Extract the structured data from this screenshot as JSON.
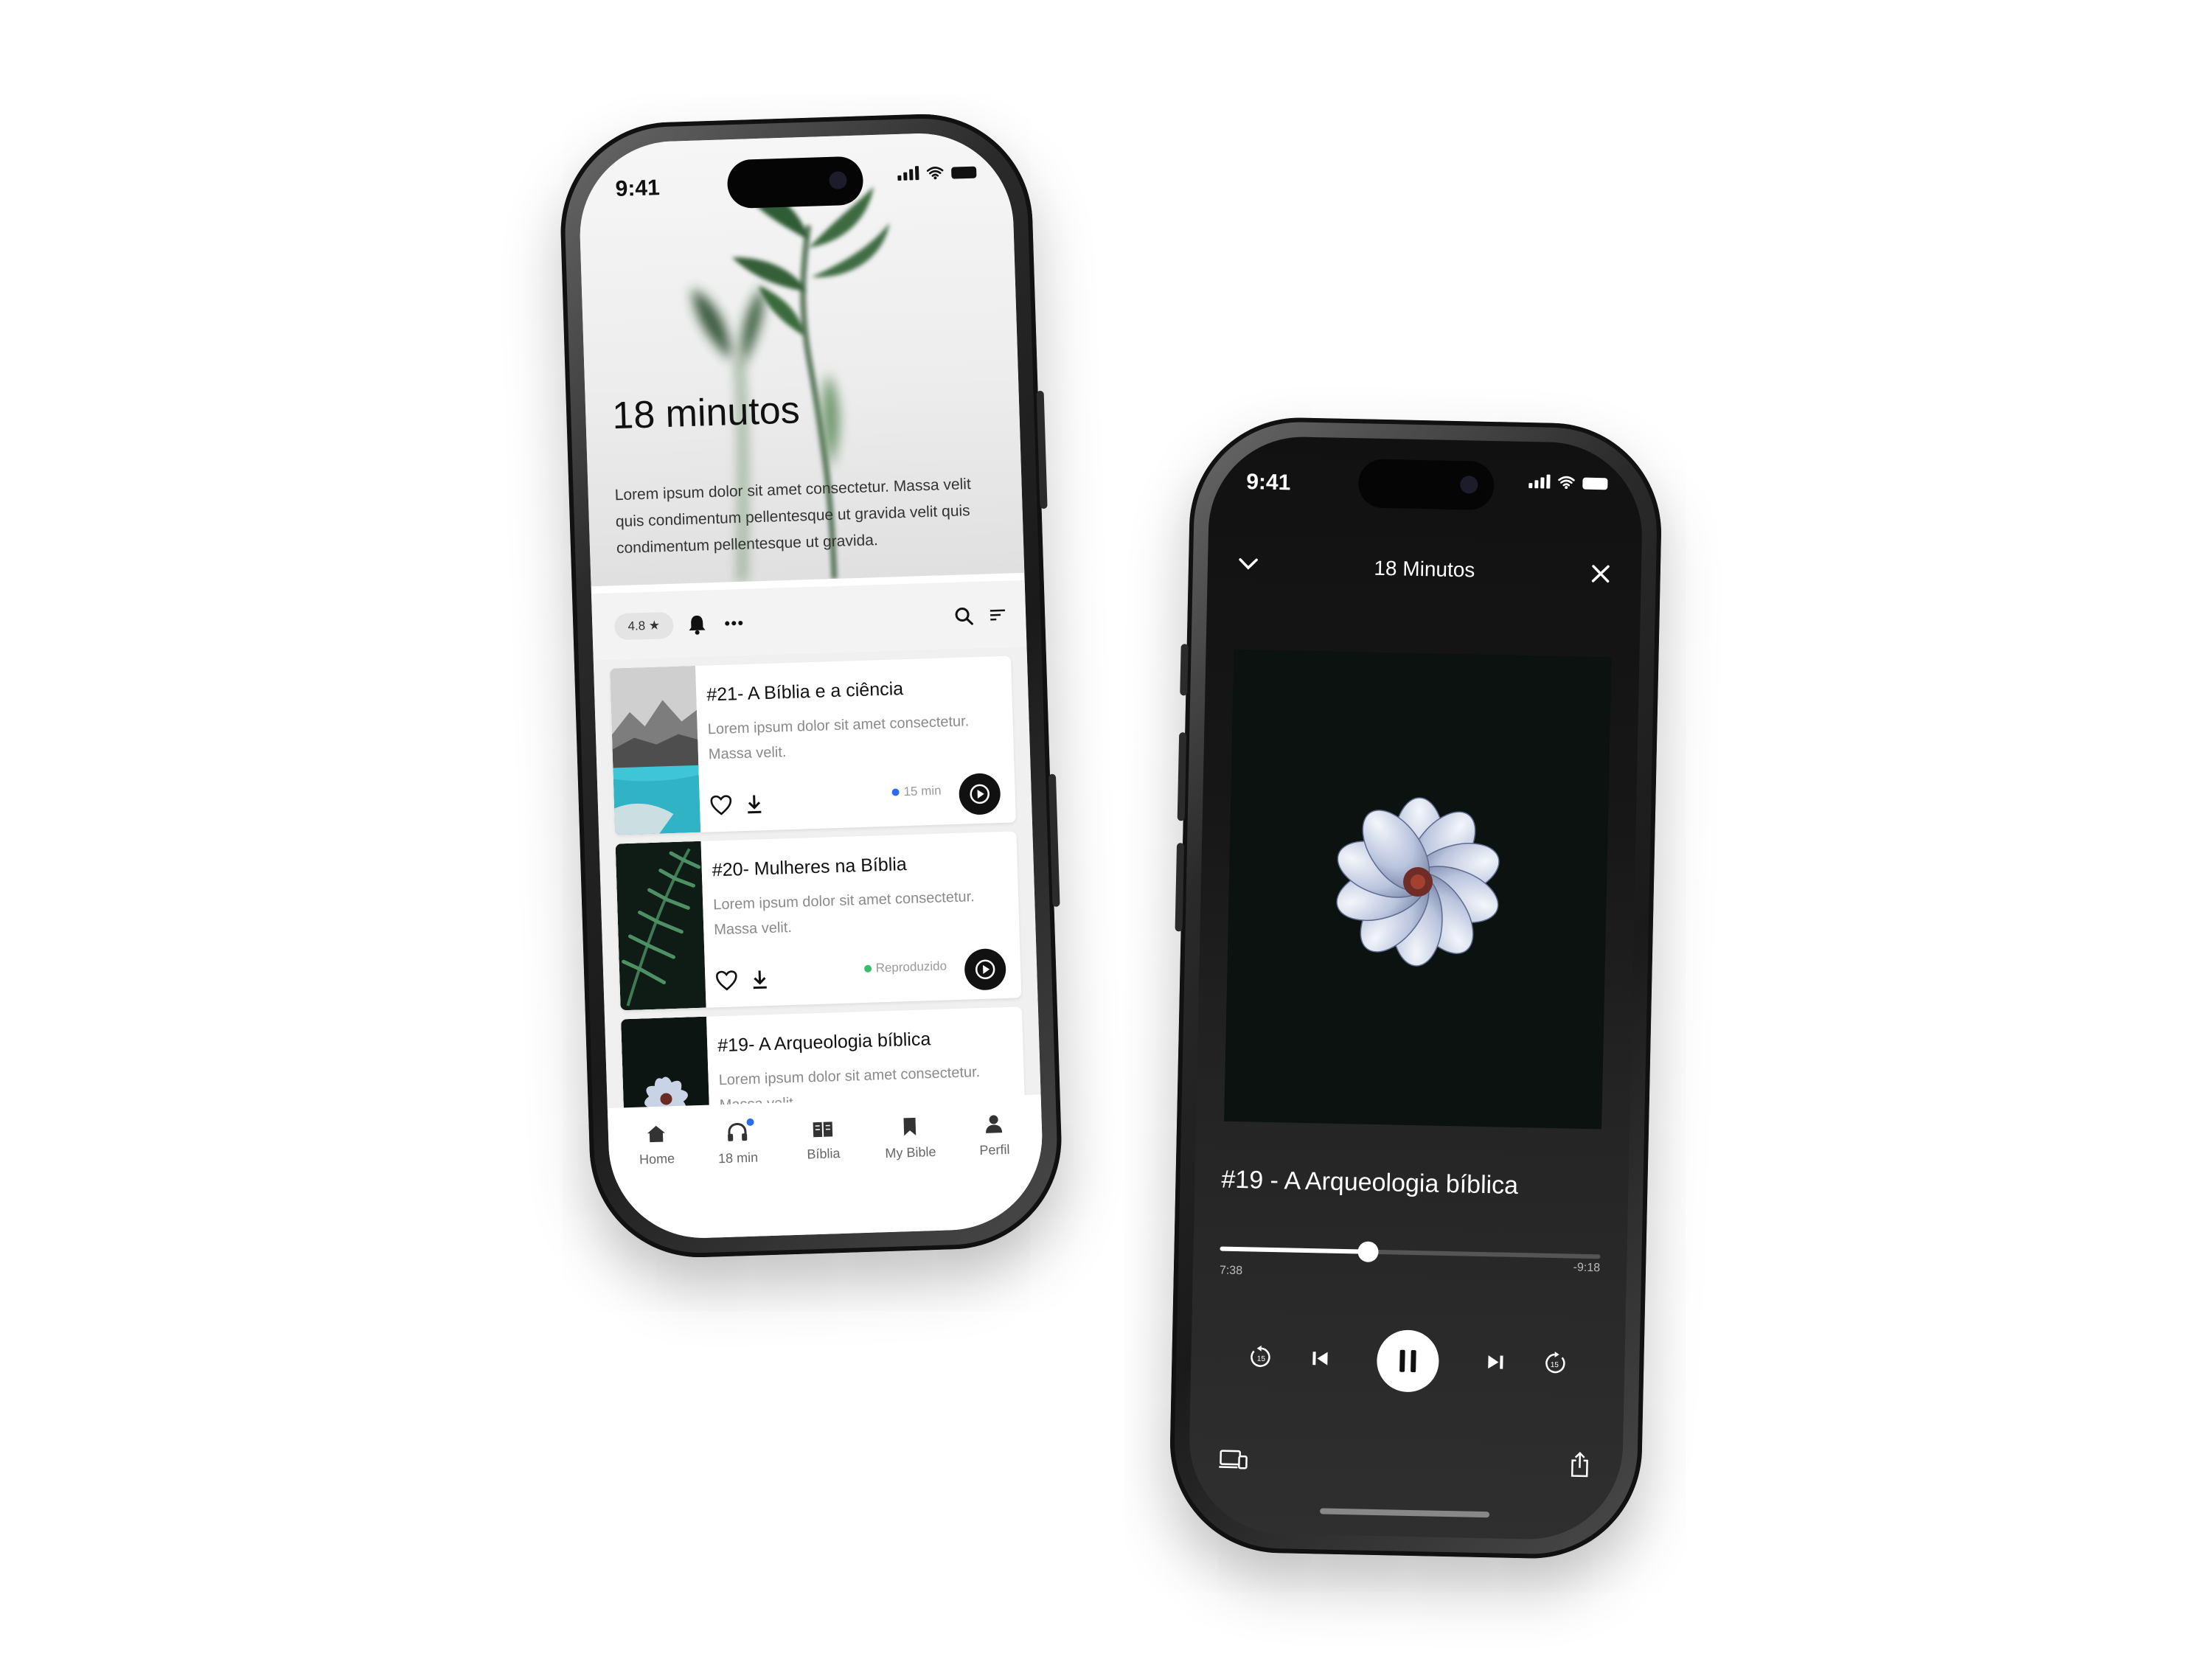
{
  "left_phone": {
    "status_time": "9:41",
    "hero": {
      "title": "18 minutos",
      "description": "Lorem ipsum dolor sit amet consectetur. Massa velit quis condimentum pellentesque ut gravida  velit quis condimentum pellentesque ut gravida."
    },
    "toolbar": {
      "rating": "4.8 ★"
    },
    "episodes": [
      {
        "title": "#21- A Bíblia e a ciência",
        "desc": "Lorem ipsum dolor sit amet consectetur. Massa velit.",
        "meta": "15 min",
        "meta_color": "#2b6cf0",
        "thumb": "lake-mountains"
      },
      {
        "title": "#20- Mulheres na Bíblia",
        "desc": "Lorem ipsum dolor sit amet consectetur. Massa velit.",
        "meta": "Reproduzido",
        "meta_color": "#34c06a",
        "thumb": "fern"
      },
      {
        "title": "#19- A Arqueologia bíblica",
        "desc": "Lorem ipsum dolor sit amet consectetur. Massa velit.",
        "meta": "",
        "thumb": "flower"
      }
    ],
    "tabs": [
      {
        "label": "Home",
        "icon": "home-icon"
      },
      {
        "label": "18 min",
        "icon": "headphones-icon"
      },
      {
        "label": "Bíblia",
        "icon": "book-icon"
      },
      {
        "label": "My Bible",
        "icon": "bookmark-icon"
      },
      {
        "label": "Perfil",
        "icon": "person-icon"
      }
    ]
  },
  "right_phone": {
    "status_time": "9:41",
    "header_title": "18 Minutos",
    "track_title": "#19 - A Arqueologia bíblica",
    "elapsed": "7:38",
    "remaining": "-9:18",
    "progress": 0.39
  }
}
